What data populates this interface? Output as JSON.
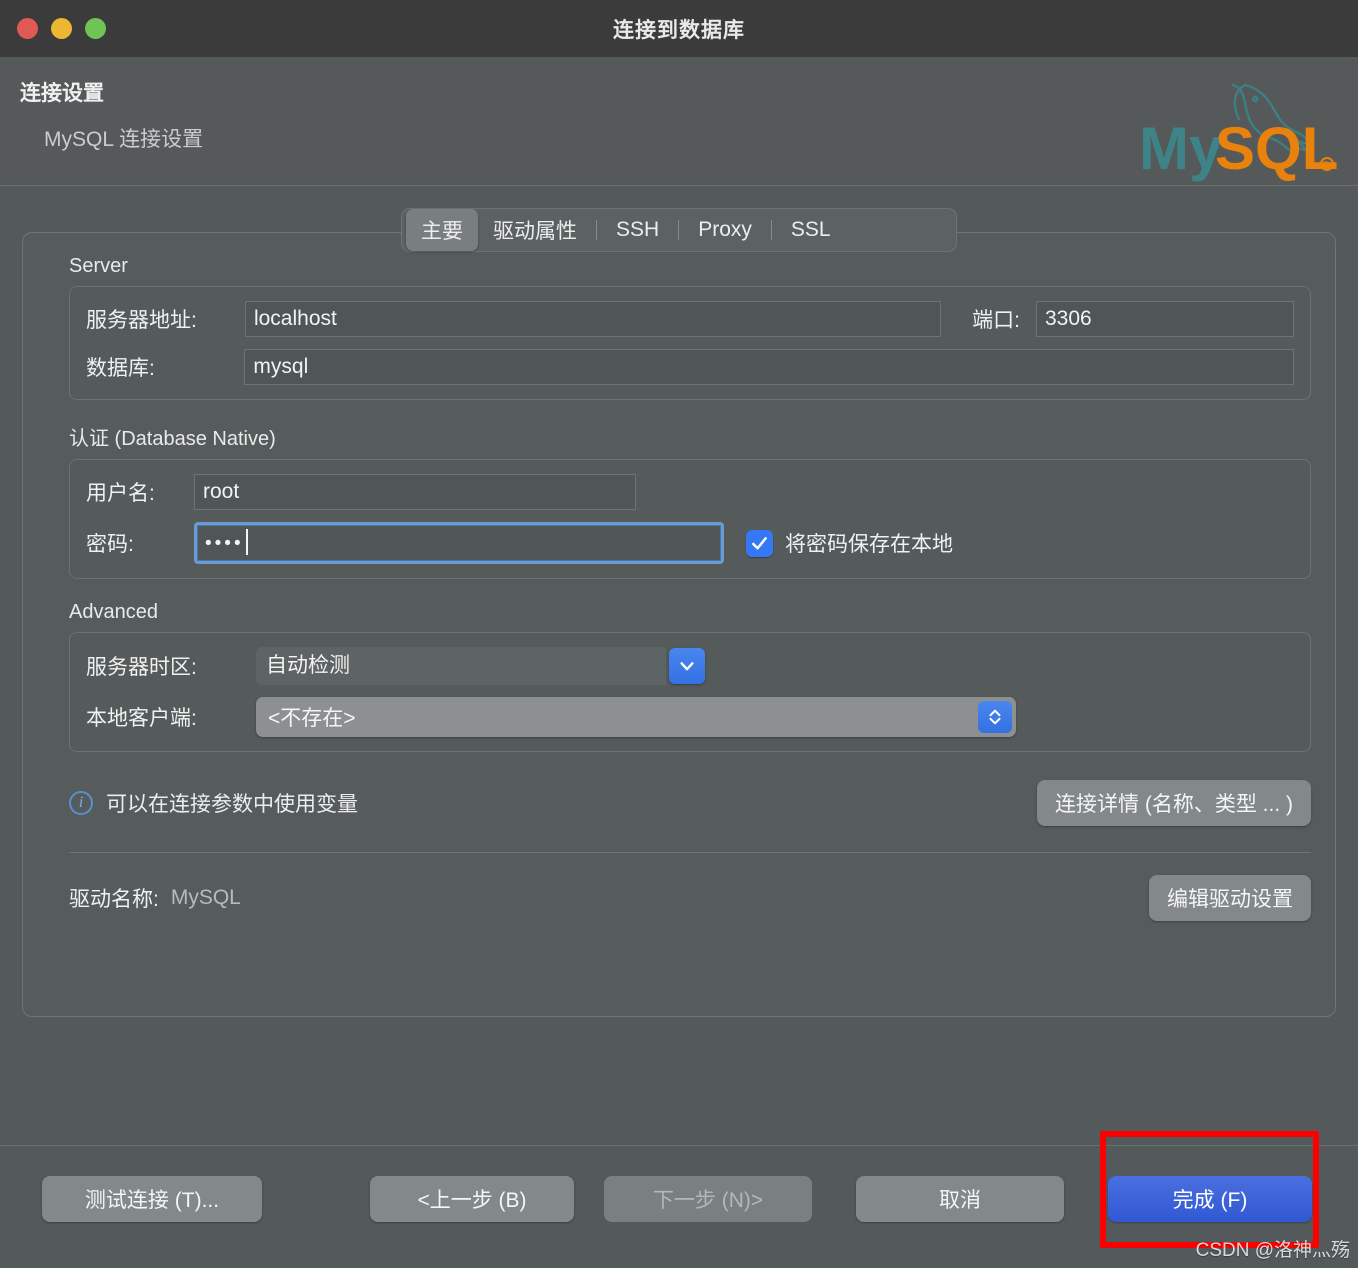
{
  "window": {
    "title": "连接到数据库",
    "traffic_lights": [
      "close-red",
      "minimize-yellow",
      "zoom-green"
    ]
  },
  "header": {
    "title": "连接设置",
    "subtitle": "MySQL 连接设置",
    "logo_text_left": "My",
    "logo_text_right": "SQL",
    "logo_reg_mark": "®"
  },
  "tabs": [
    {
      "label": "主要",
      "active": true
    },
    {
      "label": "驱动属性",
      "active": false
    },
    {
      "label": "SSH",
      "active": false
    },
    {
      "label": "Proxy",
      "active": false
    },
    {
      "label": "SSL",
      "active": false
    }
  ],
  "server_group": {
    "title": "Server",
    "host_label": "服务器地址:",
    "host_value": "localhost",
    "port_label": "端口:",
    "port_value": "3306",
    "database_label": "数据库:",
    "database_value": "mysql"
  },
  "auth_group": {
    "title": "认证 (Database Native)",
    "username_label": "用户名:",
    "username_value": "root",
    "password_label": "密码:",
    "password_value": "••••",
    "save_password_label": "将密码保存在本地",
    "save_password_checked": true
  },
  "advanced_group": {
    "title": "Advanced",
    "timezone_label": "服务器时区:",
    "timezone_value": "自动检测",
    "local_client_label": "本地客户端:",
    "local_client_value": "<不存在>"
  },
  "info": {
    "text": "可以在连接参数中使用变量",
    "icon": "info-circle-icon"
  },
  "connection_details_button": "连接详情 (名称、类型 ... )",
  "driver": {
    "label": "驱动名称:",
    "value": "MySQL",
    "edit_button": "编辑驱动设置"
  },
  "footer_buttons": {
    "test": "测试连接 (T)...",
    "back": "<上一步 (B)",
    "next": "下一步 (N)>",
    "next_disabled": true,
    "cancel": "取消",
    "finish": "完成 (F)"
  },
  "annotation": {
    "highlight_color": "#fc0000",
    "watermark": "CSDN @洛神灬殇"
  }
}
